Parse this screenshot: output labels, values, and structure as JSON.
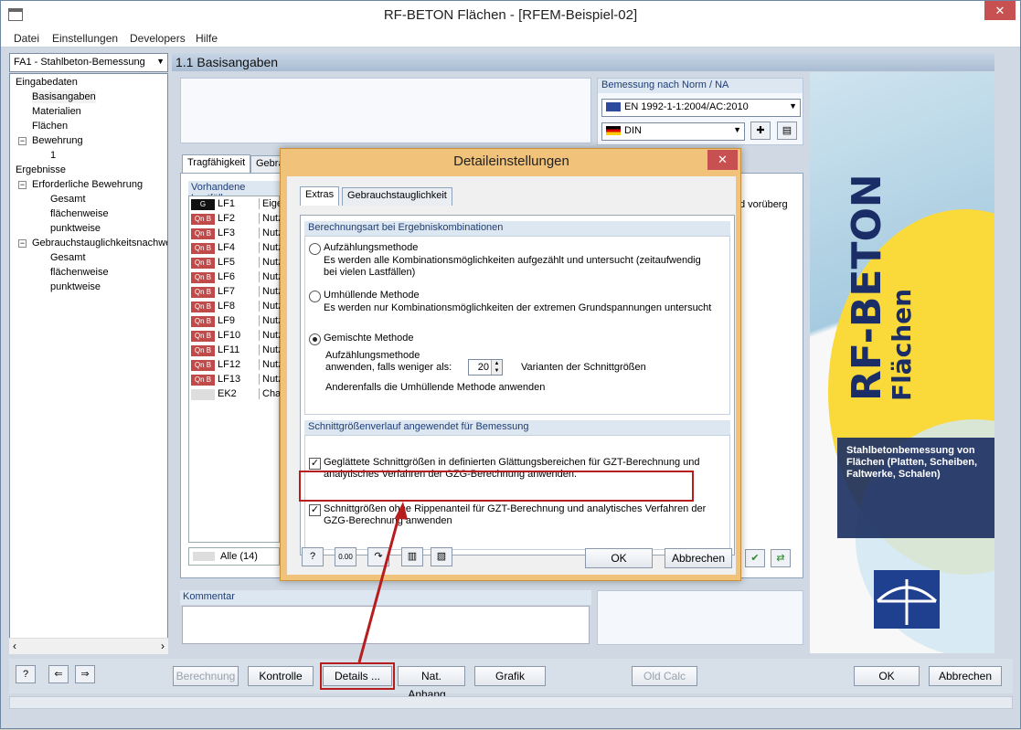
{
  "window": {
    "title": "RF-BETON Flächen - [RFEM-Beispiel-02]",
    "close_glyph": "✕"
  },
  "menu": [
    "Datei",
    "Einstellungen",
    "Developers",
    "Hilfe"
  ],
  "navigator": {
    "combo": "FA1 - Stahlbeton-Bemessung",
    "items": [
      "Eingabedaten",
      "Basisangaben",
      "Materialien",
      "Flächen",
      "Bewehrung",
      "1",
      "Ergebnisse",
      "Erforderliche Bewehrung",
      "Gesamt",
      "flächenweise",
      "punktweise",
      "Gebrauchstauglichkeitsnachwe",
      "Gesamt",
      "flächenweise",
      "punktweise"
    ]
  },
  "section": {
    "title": "1.1 Basisangaben"
  },
  "norm": {
    "title": "Bemessung nach Norm / NA",
    "standard": "EN 1992-1-1:2004/AC:2010",
    "national_annex": "DIN"
  },
  "tabs": [
    "Tragfähigkeit",
    "Gebra"
  ],
  "loadcases": {
    "title": "Vorhandene Lastfälle",
    "rows": [
      {
        "badge": "G",
        "id": "LF1",
        "desc": "Eigen"
      },
      {
        "badge": "Qn B",
        "id": "LF2",
        "desc": "Nutzl"
      },
      {
        "badge": "Qn B",
        "id": "LF3",
        "desc": "Nutzl"
      },
      {
        "badge": "Qn B",
        "id": "LF4",
        "desc": "Nutzl"
      },
      {
        "badge": "Qn B",
        "id": "LF5",
        "desc": "Nutzl"
      },
      {
        "badge": "Qn B",
        "id": "LF6",
        "desc": "Nutzl"
      },
      {
        "badge": "Qn B",
        "id": "LF7",
        "desc": "Nutzl"
      },
      {
        "badge": "Qn B",
        "id": "LF8",
        "desc": "Nutzl"
      },
      {
        "badge": "Qn B",
        "id": "LF9",
        "desc": "Nutzl"
      },
      {
        "badge": "Qn B",
        "id": "LF10",
        "desc": "Nutzl"
      },
      {
        "badge": "Qn B",
        "id": "LF11",
        "desc": "Nutzl"
      },
      {
        "badge": "Qn B",
        "id": "LF12",
        "desc": "Nutzl"
      },
      {
        "badge": "Qn B",
        "id": "LF13",
        "desc": "Nutzl"
      },
      {
        "badge": "",
        "id": "EK2",
        "desc": "Chara"
      }
    ],
    "all": "Alle (14)",
    "right_text": "d vorüberg"
  },
  "comment": {
    "title": "Kommentar"
  },
  "graphic": {
    "line1": "RF-BETON",
    "line2": "Flächen",
    "description": "Stahlbetonbemessung von Flächen (Platten, Scheiben, Faltwerke, Schalen)"
  },
  "bottom": {
    "berechnung": "Berechnung",
    "kontrolle": "Kontrolle",
    "details": "Details ...",
    "anhang": "Nat. Anhang...",
    "grafik": "Grafik",
    "oldcalc": "Old Calc",
    "ok": "OK",
    "abbrechen": "Abbrechen"
  },
  "dialog": {
    "title": "Detaileinstellungen",
    "close_glyph": "✕",
    "tabs": [
      "Extras",
      "Gebrauchstauglichkeit"
    ],
    "group1": {
      "title": "Berechnungsart bei Ergebniskombinationen",
      "opt1_label": "Aufzählungsmethode",
      "opt1_desc": "Es werden alle Kombinationsmöglichkeiten aufgezählt und untersucht (zeitaufwendig bei vielen Lastfällen)",
      "opt2_label": "Umhüllende Methode",
      "opt2_desc": "Es werden nur Kombinationsmöglichkeiten der extremen Grundspannungen untersucht",
      "opt3_label": "Gemischte Methode",
      "opt3_line1": "Aufzählungsmethode",
      "opt3_line2": "anwenden, falls weniger als:",
      "opt3_value": "20",
      "opt3_unit": "Varianten der Schnittgrößen",
      "opt3_line3": "Anderenfalls die Umhüllende Methode anwenden"
    },
    "group2": {
      "title": "Schnittgrößenverlauf angewendet für Bemessung",
      "check1": "Geglättete Schnittgrößen in definierten Glättungsbereichen für GZT-Berechnung und analytisches Verfahren der GZG-Berechnung anwenden.",
      "check2": "Schnittgrößen ohne Rippenanteil für GZT-Berechnung und analytisches Verfahren der GZG-Berechnung anwenden"
    },
    "ok": "OK",
    "cancel": "Abbrechen",
    "spin_value": "0.00"
  },
  "colors": {
    "highlight": "#b81d1d",
    "dialog_frame": "#f0c27a",
    "header": "#a9bcd3"
  }
}
